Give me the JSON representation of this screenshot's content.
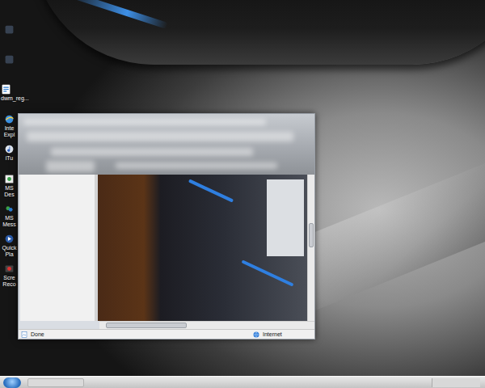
{
  "desktop": {
    "icons": [
      {
        "lines": [
          "dwm_reg..."
        ]
      },
      {
        "lines": [
          "Inte",
          "Expl"
        ]
      },
      {
        "lines": [
          "iTu"
        ]
      },
      {
        "lines": [
          "MS",
          "Des"
        ]
      },
      {
        "lines": [
          "MS",
          "Mess"
        ]
      },
      {
        "lines": [
          "Quick",
          "Pla"
        ]
      },
      {
        "lines": [
          "Scre",
          "Reco"
        ]
      }
    ]
  },
  "browser": {
    "status": "Done",
    "zone": "Internet",
    "vscroll": {
      "level": 0.4
    },
    "hscroll": {
      "level": 0.05
    }
  }
}
